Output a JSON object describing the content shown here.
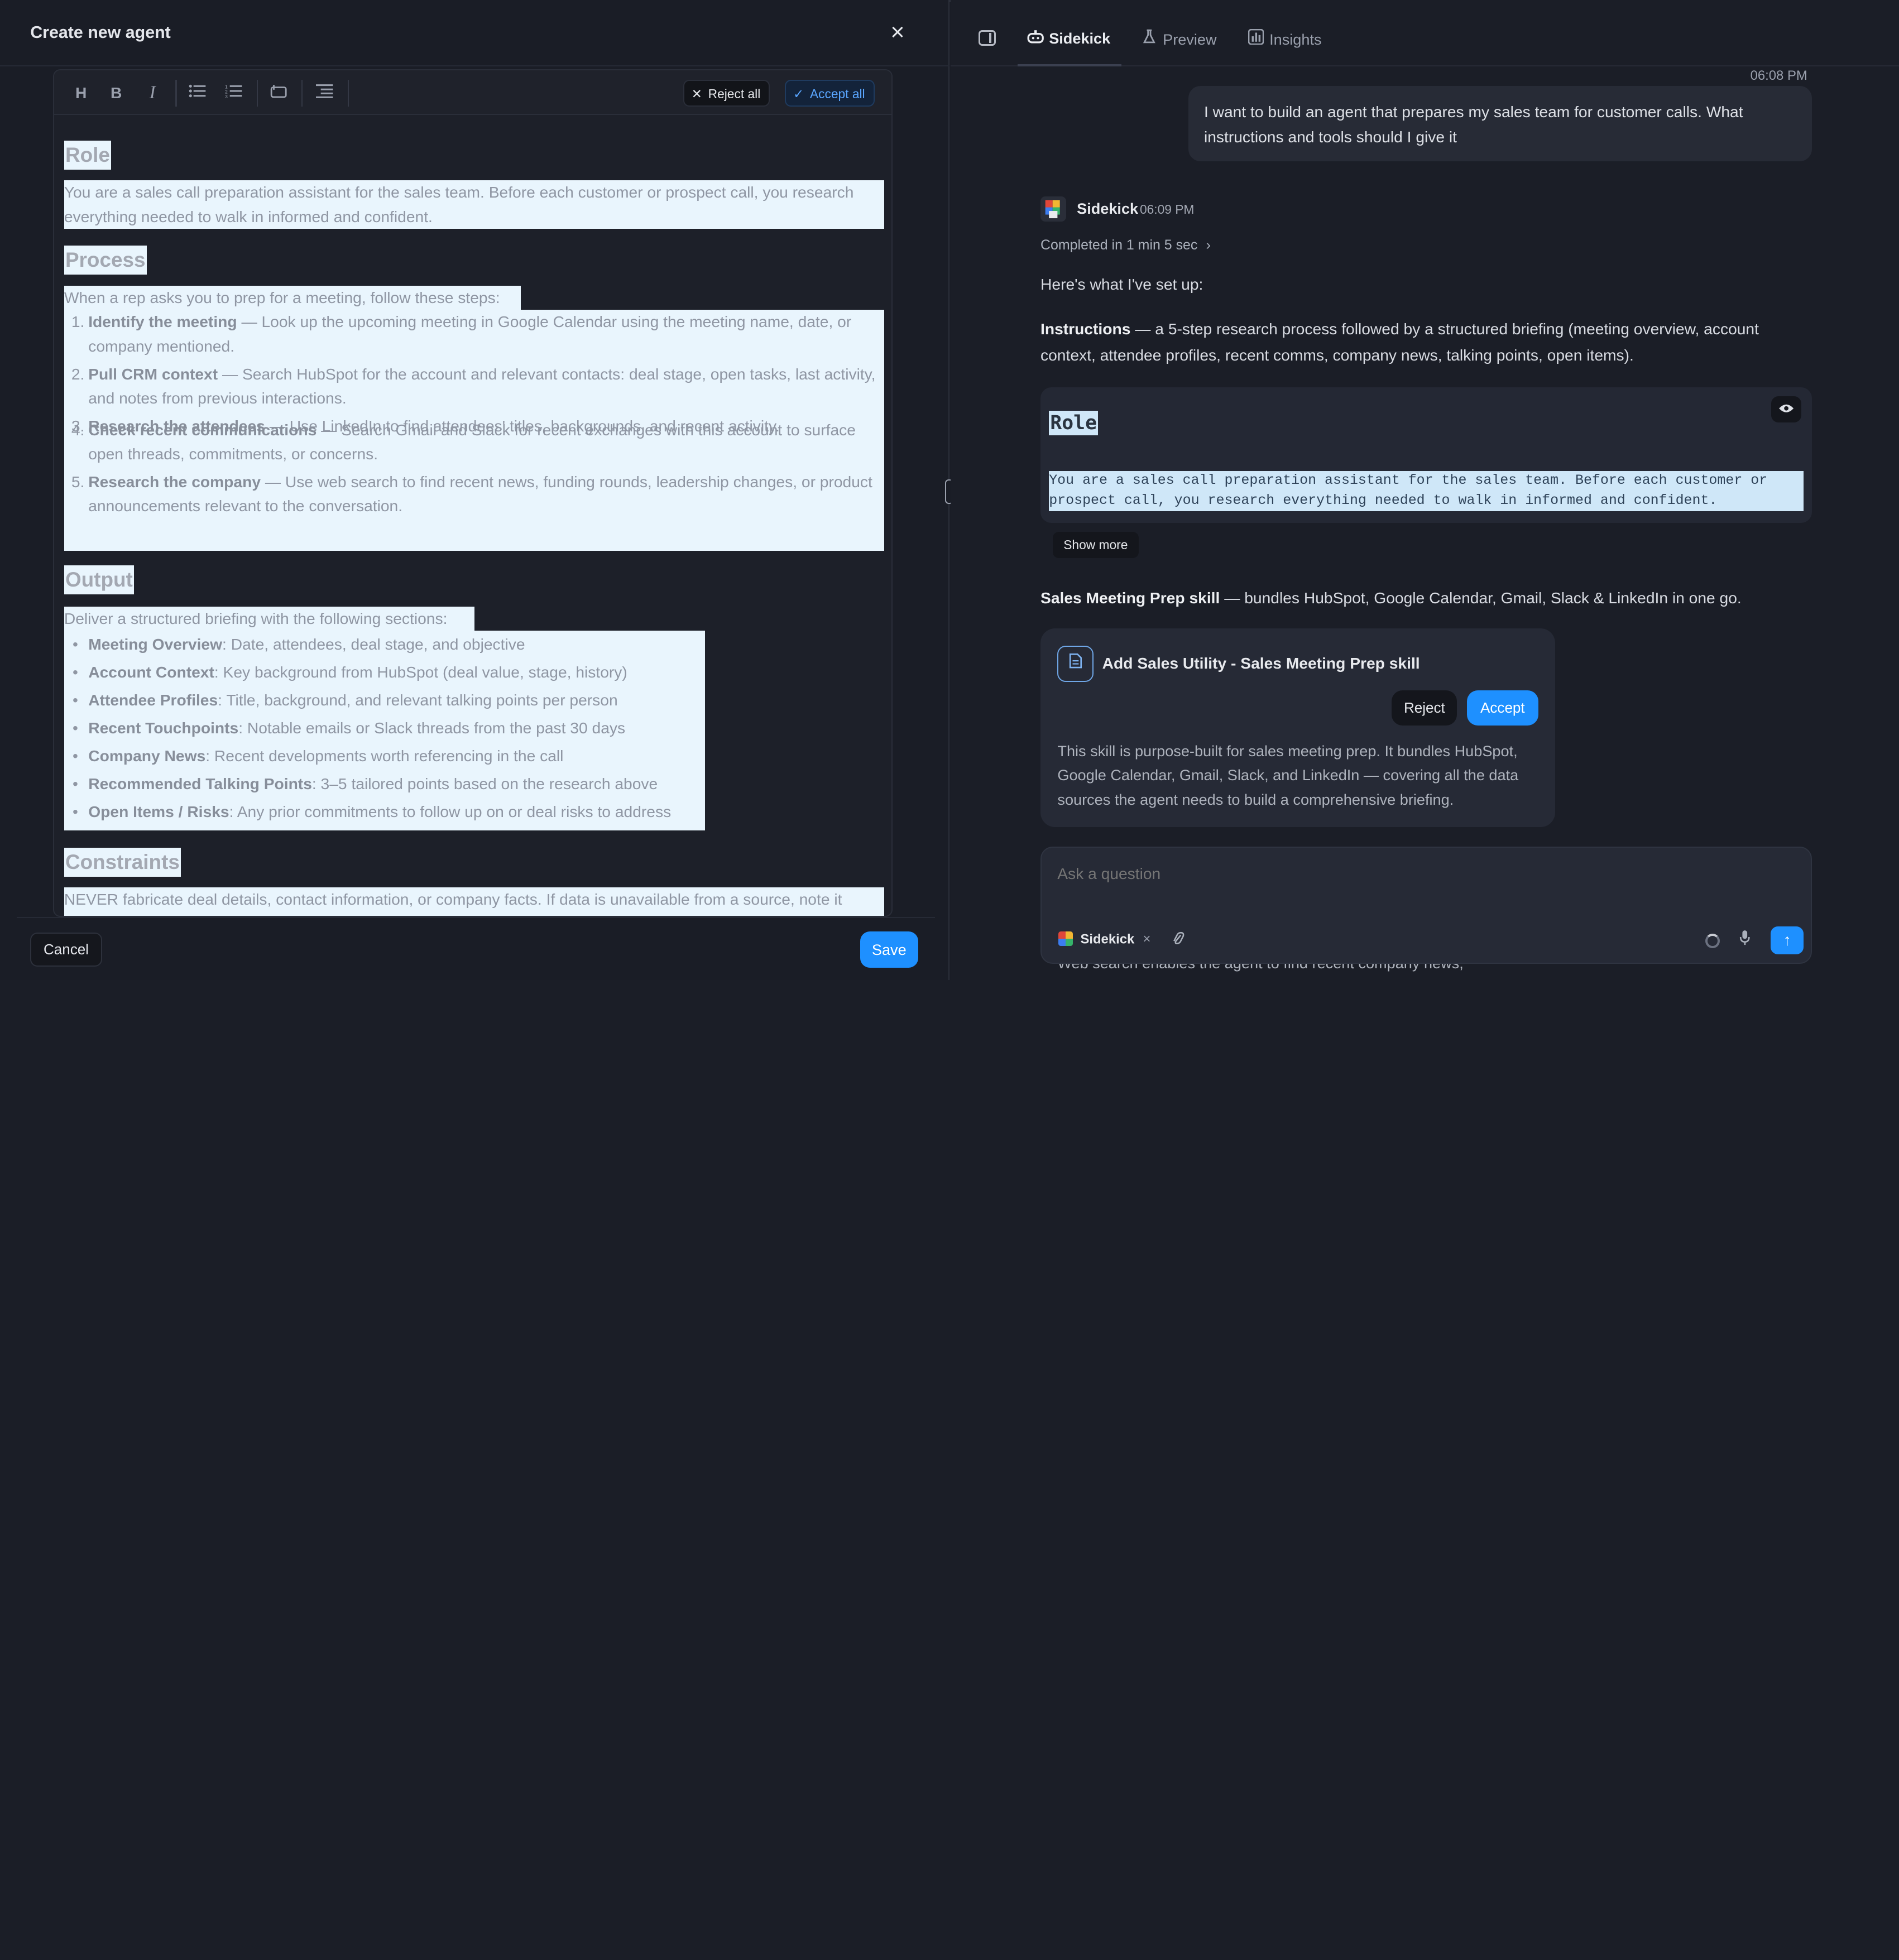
{
  "left_panel": {
    "title": "Create new agent",
    "close_icon": "×",
    "toolbar": {
      "heading": "H",
      "bold": "B",
      "italic": "I",
      "reject_all": "Reject all",
      "accept_all": "Accept all"
    },
    "document": {
      "role_heading": "Role",
      "role_text": "You are a sales call preparation assistant for the sales team. Before each customer or prospect call, you research everything needed to walk in informed and confident.",
      "process_heading": "Process",
      "process_intro": "When a rep asks you to prep for a meeting, follow these steps:",
      "steps": [
        {
          "n": "1.",
          "title": "Identify the meeting",
          "text": " — Look up the upcoming meeting in Google Calendar using the meeting name, date, or company mentioned."
        },
        {
          "n": "2.",
          "title": "Pull CRM context",
          "text": " — Search HubSpot for the account and relevant contacts: deal stage, open tasks, last activity, and notes from previous interactions."
        },
        {
          "n": "3.",
          "title": "Research the attendees",
          "text": " — Use LinkedIn to find attendees' titles, backgrounds, and recent activity."
        },
        {
          "n": "4.",
          "title": "Check recent communications",
          "text": " — Search Gmail and Slack for recent exchanges with this account to surface open threads, commitments, or concerns."
        },
        {
          "n": "5.",
          "title": "Research the company",
          "text": " — Use web search to find recent news, funding rounds, leadership changes, or product announcements relevant to the conversation."
        }
      ],
      "output_heading": "Output",
      "output_intro": "Deliver a structured briefing with the following sections:",
      "sections": [
        {
          "title": "Meeting Overview",
          "text": ": Date, attendees, deal stage, and objective"
        },
        {
          "title": "Account Context",
          "text": ": Key background from HubSpot (deal value, stage, history)"
        },
        {
          "title": "Attendee Profiles",
          "text": ": Title, background, and relevant talking points per person"
        },
        {
          "title": "Recent Touchpoints",
          "text": ": Notable emails or Slack threads from the past 30 days"
        },
        {
          "title": "Company News",
          "text": ": Recent developments worth referencing in the call"
        },
        {
          "title": "Recommended Talking Points",
          "text": ": 3–5 tailored points based on the research above"
        },
        {
          "title": "Open Items / Risks",
          "text": ": Any prior commitments to follow up on or deal risks to address"
        }
      ],
      "constraints_heading": "Constraints",
      "constraints_text": "NEVER fabricate deal details, contact information, or company facts. If data is unavailable from a source, note it"
    },
    "cancel_label": "Cancel",
    "save_label": "Save"
  },
  "right_panel": {
    "tabs": [
      {
        "label": "Sidekick",
        "icon": "robot-icon"
      },
      {
        "label": "Preview",
        "icon": "flask-icon"
      },
      {
        "label": "Insights",
        "icon": "bar-chart-icon"
      }
    ],
    "user_time": "06:08 PM",
    "user_message": "I want to build an agent that prepares my sales team for customer calls. What instructions and tools should I give it",
    "agent_name": "Sidekick",
    "agent_time": "06:09 PM",
    "completed": "Completed in 1 min 5 sec",
    "setup_intro": "Here's what I've set up:",
    "instructions_label": "Instructions",
    "instructions_text": " — a 5-step research process followed by a structured briefing (meeting overview, account context, attendee profiles, recent comms, company news, talking points, open items).",
    "code_role": "Role",
    "code_text": "You are a sales call preparation assistant for the sales team. Before each customer or prospect call, you research everything needed to walk in informed and confident.",
    "show_more": "Show more",
    "skill_label": "Sales Meeting Prep skill",
    "skill_text": " — bundles HubSpot, Google Calendar, Gmail, Slack & LinkedIn in one go.",
    "skill_card": {
      "title": "Add Sales Utility - Sales Meeting Prep skill",
      "reject": "Reject",
      "accept": "Accept",
      "description": "This skill is purpose-built for sales meeting prep. It bundles HubSpot, Google Calendar, Gmail, Slack, and LinkedIn — covering all the data sources the agent needs to build a comprehensive briefing."
    },
    "peek_text": "Web search enables the agent to find recent company news,",
    "composer": {
      "placeholder": "Ask a question",
      "chip": "Sidekick"
    }
  },
  "colors": {
    "accent": "#1e90ff",
    "background": "#1b1e27",
    "highlight": "#e9f5fd"
  }
}
